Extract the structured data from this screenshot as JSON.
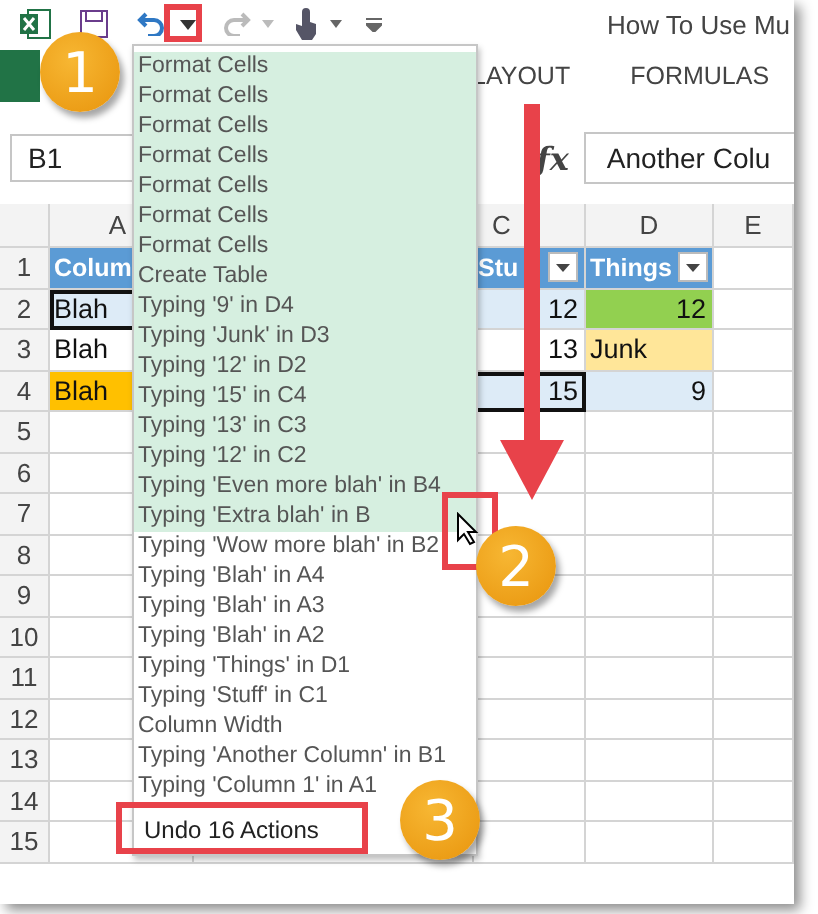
{
  "title": "How To Use Mu",
  "ribbon_tabs": [
    {
      "label": "LAYOUT"
    },
    {
      "label": "FORMULAS"
    }
  ],
  "name_box": "B1",
  "function_label": "fx",
  "formula": "Another Colu",
  "column_headers": [
    {
      "label": "A"
    },
    {
      "label": "C"
    },
    {
      "label": "D"
    },
    {
      "label": "E"
    }
  ],
  "rows": [
    {
      "number": "1",
      "cells": [
        {
          "text": "Colum",
          "kind": "header"
        },
        {
          "text": "Stu",
          "kind": "header",
          "filter": true
        },
        {
          "text": "Things",
          "kind": "header",
          "filter": true
        }
      ]
    },
    {
      "number": "2",
      "banded": true,
      "cells": [
        {
          "text": "Blah",
          "kind": "text",
          "outlined": true
        },
        {
          "text": "12",
          "kind": "number"
        },
        {
          "text": "12",
          "kind": "number",
          "color": "#92d050"
        }
      ]
    },
    {
      "number": "3",
      "banded": false,
      "cells": [
        {
          "text": "Blah",
          "kind": "text"
        },
        {
          "text": "13",
          "kind": "number"
        },
        {
          "text": "Junk",
          "kind": "text",
          "color": "#ffe699"
        }
      ]
    },
    {
      "number": "4",
      "banded": true,
      "cells": [
        {
          "text": "Blah",
          "kind": "text",
          "color": "#ffc000"
        },
        {
          "text": "15",
          "kind": "number",
          "outlined": true
        },
        {
          "text": "9",
          "kind": "number"
        }
      ]
    },
    {
      "number": "5"
    },
    {
      "number": "6"
    },
    {
      "number": "7"
    },
    {
      "number": "8"
    },
    {
      "number": "9"
    },
    {
      "number": "10"
    },
    {
      "number": "11"
    },
    {
      "number": "12"
    },
    {
      "number": "13"
    },
    {
      "number": "14"
    },
    {
      "number": "15"
    }
  ],
  "undo_list": {
    "items": [
      {
        "label": "Format Cells",
        "selected": true
      },
      {
        "label": "Format Cells",
        "selected": true
      },
      {
        "label": "Format Cells",
        "selected": true
      },
      {
        "label": "Format Cells",
        "selected": true
      },
      {
        "label": "Format Cells",
        "selected": true
      },
      {
        "label": "Format Cells",
        "selected": true
      },
      {
        "label": "Format Cells",
        "selected": true
      },
      {
        "label": "Create Table",
        "selected": true
      },
      {
        "label": "Typing '9' in D4",
        "selected": true
      },
      {
        "label": "Typing 'Junk' in D3",
        "selected": true
      },
      {
        "label": "Typing '12' in D2",
        "selected": true
      },
      {
        "label": "Typing '15' in C4",
        "selected": true
      },
      {
        "label": "Typing '13' in C3",
        "selected": true
      },
      {
        "label": "Typing '12' in C2",
        "selected": true
      },
      {
        "label": "Typing 'Even more blah' in B4",
        "selected": true
      },
      {
        "label": "Typing 'Extra blah' in B",
        "selected": true
      },
      {
        "label": "Typing 'Wow more blah' in B2",
        "selected": false
      },
      {
        "label": "Typing 'Blah' in A4",
        "selected": false
      },
      {
        "label": "Typing 'Blah' in A3",
        "selected": false
      },
      {
        "label": "Typing 'Blah' in A2",
        "selected": false
      },
      {
        "label": "Typing 'Things' in D1",
        "selected": false
      },
      {
        "label": "Typing 'Stuff' in C1",
        "selected": false
      },
      {
        "label": "Column Width",
        "selected": false
      },
      {
        "label": "Typing 'Another Column' in B1",
        "selected": false
      },
      {
        "label": "Typing 'Column 1' in A1",
        "selected": false
      }
    ],
    "footer": "Undo 16 Actions"
  },
  "callouts": [
    {
      "number": "1"
    },
    {
      "number": "2"
    },
    {
      "number": "3"
    }
  ]
}
